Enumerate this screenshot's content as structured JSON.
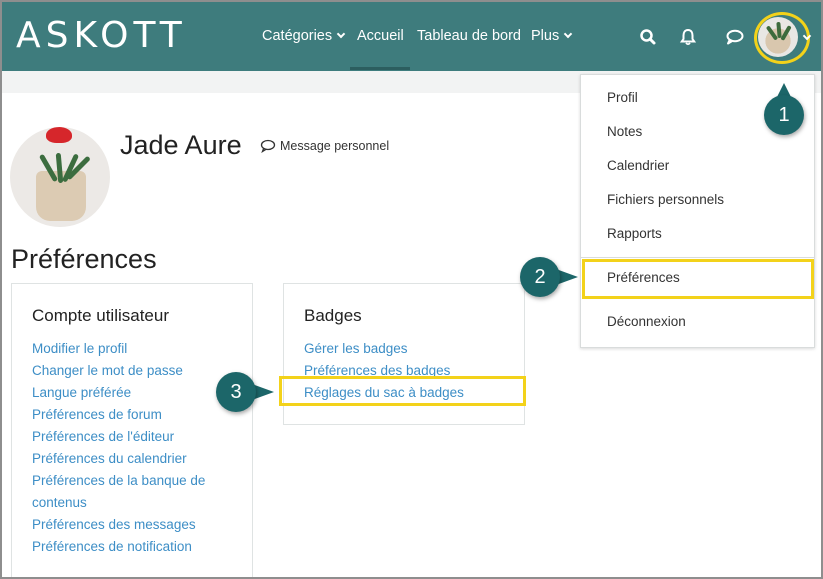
{
  "navbar": {
    "logo": "ASKOTT",
    "items": [
      {
        "label": "Catégories",
        "dropdown": true
      },
      {
        "label": "Accueil",
        "dropdown": false
      },
      {
        "label": "Tableau de bord",
        "dropdown": false
      },
      {
        "label": "Plus",
        "dropdown": true
      }
    ],
    "icons": [
      "search-icon",
      "bell-icon",
      "chat-icon"
    ],
    "color": "#3e7c7d"
  },
  "profile": {
    "name": "Jade Aure",
    "message_link": "Message personnel"
  },
  "page_title": "Préférences",
  "cards": [
    {
      "title": "Compte utilisateur",
      "links": [
        "Modifier le profil",
        "Changer le mot de passe",
        "Langue préférée",
        "Préférences de forum",
        "Préférences de l'éditeur",
        "Préférences du calendrier",
        "Préférences de la banque de",
        "contenus",
        "Préférences des messages",
        "Préférences de notification"
      ]
    },
    {
      "title": "Badges",
      "links": [
        "Gérer les badges",
        "Préférences des badges",
        "Réglages du sac à badges"
      ]
    }
  ],
  "user_menu": {
    "items": [
      "Profil",
      "Notes",
      "Calendrier",
      "Fichiers personnels",
      "Rapports",
      "Préférences",
      "Déconnexion"
    ]
  },
  "callouts": [
    "1",
    "2",
    "3"
  ],
  "colors": {
    "highlight": "#f3d21a",
    "callout": "#1c6669",
    "link": "#3d8ec6"
  }
}
